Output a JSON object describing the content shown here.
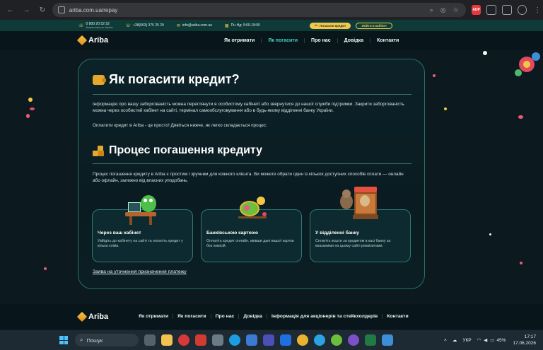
{
  "browser": {
    "url": "ariba.com.ua/repay"
  },
  "topbar": {
    "phone1": "0 800 20 52 52",
    "phone1_sub": "безкоштовно по Україні",
    "phone2": "+38(063) 375 25 29",
    "email": "info@ariba.com.ua",
    "hours": "Пн-Нд: 9:00-18:00",
    "pay_button": "Погасити кредит",
    "cabinet_button": "Увійти в кабінет"
  },
  "nav": {
    "logo": "Ariba",
    "items": [
      {
        "label": "Як отримати"
      },
      {
        "label": "Як погасити"
      },
      {
        "label": "Про нас"
      },
      {
        "label": "Довідка"
      },
      {
        "label": "Контакти"
      }
    ]
  },
  "main": {
    "title": "Як погасити кредит?",
    "intro": "Інформацію про вашу заборгованість можна переглянути в особистому кабінеті або звернутися до нашої служби підтримки. Закрити заборгованість можна через особистий кабінет на сайті, термінал самообслуговування або в будь-якому відділенні банку України.",
    "intro2": "Оплатити кредит в Ariba - це просто! Дивіться нижче, як легко складається процес:",
    "subtitle": "Процес погашення кредиту",
    "process_text": "Процес погашення кредиту в Ariba є простим і зручним для кожного клієнта. Ви можете обрати один із кількох доступних способів сплати — онлайн або офлайн, залежно від власних уподобань.",
    "methods": [
      {
        "title": "Через ваш кабінет",
        "desc": "Увійдіть до кабінету на сайті та оплатіть кредит у кілька кліків."
      },
      {
        "title": "Банківською карткою",
        "desc": "Оплатіть кредит онлайн, ввівши дані вашої картки без комісій."
      },
      {
        "title": "У відділенні банку",
        "desc": "Сплатіть кошти за кредитом в касі банку за вказаними на цьому сайті реквізитами."
      }
    ],
    "link": "Заява на уточнення призначення платежу"
  },
  "footer": {
    "logo": "Ariba",
    "items": [
      {
        "label": "Як отримати"
      },
      {
        "label": "Як погасити"
      },
      {
        "label": "Про нас"
      },
      {
        "label": "Довідка"
      },
      {
        "label": "Інформація для акціонерів та стейкхолдерів"
      },
      {
        "label": "Контакти"
      }
    ]
  },
  "taskbar": {
    "search_placeholder": "Пошук",
    "lang": "УКР",
    "battery": "45%",
    "time": "17:17",
    "date": "17.06.2026"
  },
  "colors": {
    "accent": "#3fd0c0",
    "gold": "#f2c94c",
    "card_border": "#2b6f69"
  }
}
